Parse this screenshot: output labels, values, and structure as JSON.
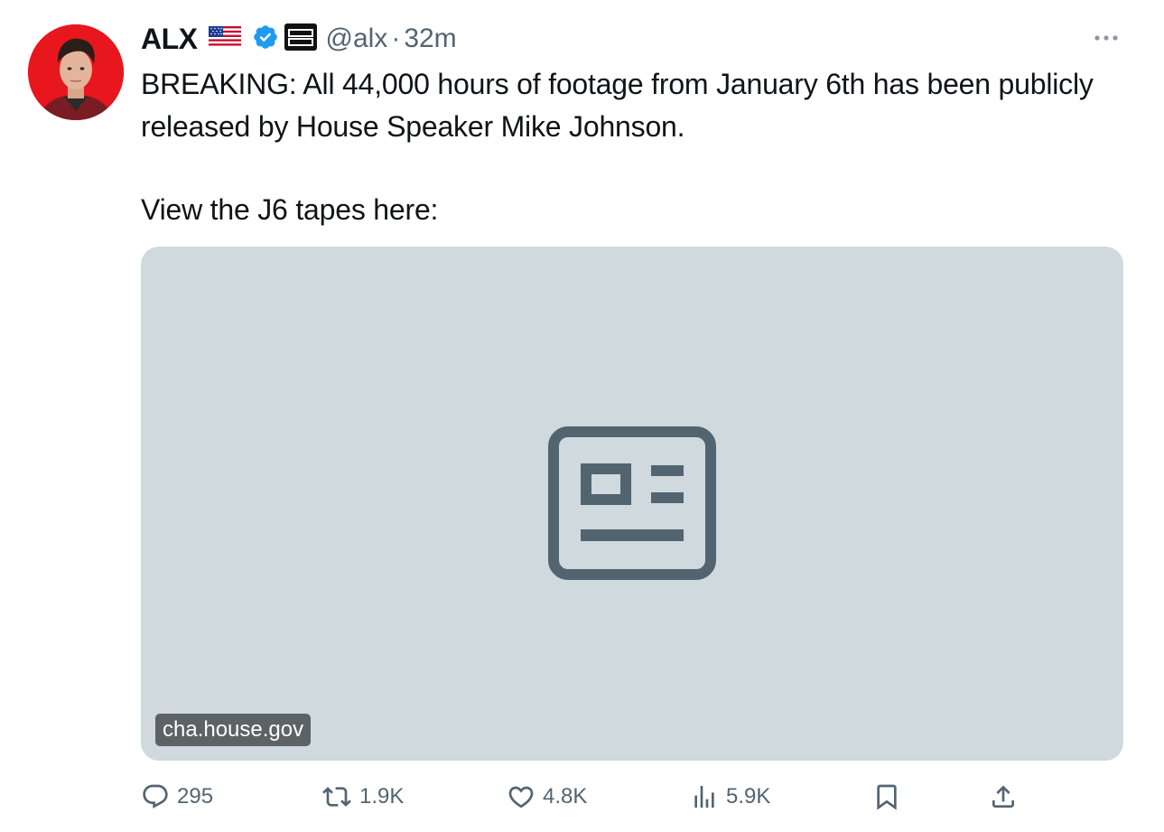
{
  "tweet": {
    "author": {
      "display_name": "ALX",
      "handle": "@alx",
      "badges": [
        "us-flag-emoji",
        "verified-badge",
        "benny-show-affiliate-badge"
      ],
      "affiliate_badge_text": "BENNY SHOW"
    },
    "separator": "·",
    "time": "32m",
    "text_lines": [
      "BREAKING: All 44,000 hours of footage from January 6th has been publicly released by House Speaker Mike Johnson.",
      "View the J6 tapes here:"
    ],
    "link_card": {
      "domain": "cha.house.gov",
      "icon": "article-icon"
    },
    "actions": {
      "replies": {
        "icon": "reply-icon",
        "count": "295"
      },
      "reposts": {
        "icon": "repost-icon",
        "count": "1.9K"
      },
      "likes": {
        "icon": "heart-icon",
        "count": "4.8K"
      },
      "views": {
        "icon": "views-icon",
        "count": "5.9K"
      },
      "bookmark": {
        "icon": "bookmark-icon"
      },
      "share": {
        "icon": "share-icon"
      }
    }
  },
  "colors": {
    "text_primary": "#0f1419",
    "text_secondary": "#536471",
    "verified_blue": "#1d9bf0",
    "card_background": "#cfd9de",
    "avatar_background": "#e8161d"
  }
}
